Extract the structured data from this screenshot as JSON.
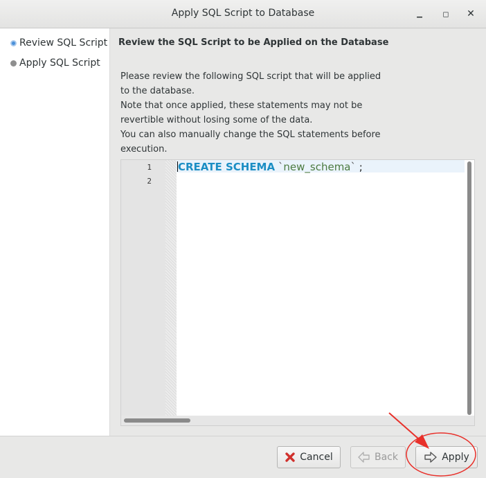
{
  "window": {
    "title": "Apply SQL Script to Database",
    "controls": {
      "minimize": "▁",
      "maximize": "◻",
      "close": "✕"
    }
  },
  "sidebar": {
    "steps": [
      {
        "label": "Review SQL Script",
        "state": "active"
      },
      {
        "label": "Apply SQL Script",
        "state": "inactive"
      }
    ]
  },
  "main": {
    "heading": "Review the SQL Script to be Applied on the Database",
    "description_lines": [
      "Please review the following SQL script that will be applied",
      "to the database.",
      "Note that once applied, these statements may not be",
      "revertible without losing some of the data.",
      "You can also manually change the SQL statements before",
      "execution."
    ]
  },
  "editor": {
    "line_numbers": [
      "1",
      "2"
    ],
    "code": {
      "keyword": "CREATE SCHEMA",
      "tick_open": "`",
      "identifier": "new_schema",
      "tick_close": "`",
      "terminator": ";"
    }
  },
  "buttons": {
    "cancel": {
      "label": "Cancel",
      "enabled": true
    },
    "back": {
      "label": "Back",
      "enabled": false
    },
    "apply": {
      "label": "Apply",
      "enabled": true
    }
  },
  "colors": {
    "keyword": "#1b8ec4",
    "identifier": "#4b7a3f",
    "annotation": "#e8302a",
    "active_step": "#4a90d9"
  }
}
